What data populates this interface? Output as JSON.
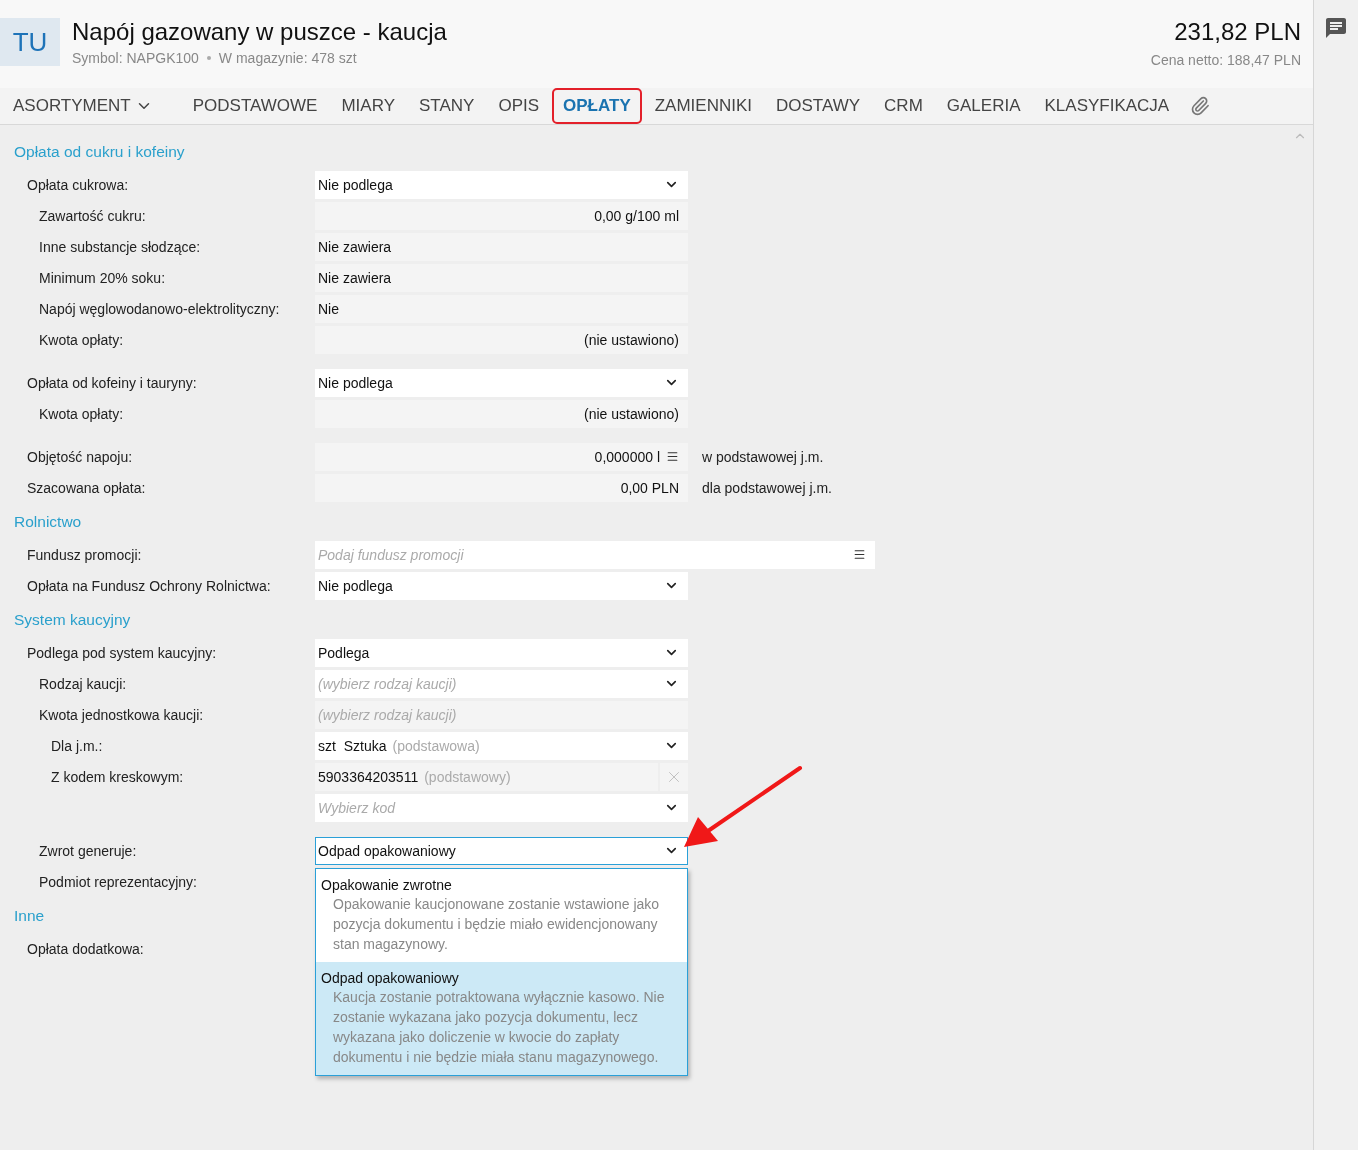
{
  "header": {
    "avatar": "TU",
    "title": "Napój gazowany w puszce - kaucja",
    "symbol": "Symbol: NAPGK100",
    "stock": "W magazynie: 478 szt",
    "price": "231,82 PLN",
    "net_price": "Cena netto: 188,47 PLN"
  },
  "tabs": [
    {
      "label": "ASORTYMENT",
      "kind": "dropdown",
      "selected": false,
      "highlighted": false
    },
    {
      "label": "PODSTAWOWE",
      "kind": "text",
      "selected": false,
      "highlighted": false
    },
    {
      "label": "MIARY",
      "kind": "text",
      "selected": false,
      "highlighted": false
    },
    {
      "label": "STANY",
      "kind": "text",
      "selected": false,
      "highlighted": false
    },
    {
      "label": "OPIS",
      "kind": "text",
      "selected": false,
      "highlighted": false
    },
    {
      "label": "OPŁATY",
      "kind": "text",
      "selected": true,
      "highlighted": true
    },
    {
      "label": "ZAMIENNIKI",
      "kind": "text",
      "selected": false,
      "highlighted": false
    },
    {
      "label": "DOSTAWY",
      "kind": "text",
      "selected": false,
      "highlighted": false
    },
    {
      "label": "CRM",
      "kind": "text",
      "selected": false,
      "highlighted": false
    },
    {
      "label": "GALERIA",
      "kind": "text",
      "selected": false,
      "highlighted": false
    },
    {
      "label": "KLASYFIKACJA",
      "kind": "text",
      "selected": false,
      "highlighted": false
    }
  ],
  "sections": [
    {
      "title": "Opłata od cukru i kofeiny",
      "rows": [
        {
          "label": "Opłata cukrowa:",
          "kind": "select",
          "value": "Nie podlega",
          "children": [
            {
              "label": "Zawartość cukru:",
              "kind": "amount",
              "value": "0,00 g/100 ml"
            },
            {
              "label": "Inne substancje słodzące:",
              "kind": "readonly",
              "value": "Nie zawiera"
            },
            {
              "label": "Minimum 20% soku:",
              "kind": "readonly",
              "value": "Nie zawiera"
            },
            {
              "label": "Napój węglowodanowo-elektrolityczny:",
              "kind": "readonly",
              "value": "Nie"
            },
            {
              "label": "Kwota opłaty:",
              "kind": "amount",
              "value": "(nie ustawiono)"
            }
          ]
        },
        {
          "label": "Opłata od kofeiny i tauryny:",
          "kind": "select",
          "value": "Nie podlega",
          "children": [
            {
              "label": "Kwota opłaty:",
              "kind": "amount",
              "value": "(nie ustawiono)"
            }
          ]
        },
        {
          "label": "Objętość napoju:",
          "kind": "amount_menu",
          "value": "0,000000 l",
          "suffix": "w podstawowej j.m."
        },
        {
          "label": "Szacowana opłata:",
          "kind": "amount",
          "value": "0,00 PLN",
          "suffix": "dla podstawowej j.m."
        }
      ]
    },
    {
      "title": "Rolnictwo",
      "rows": [
        {
          "label": "Fundusz promocji:",
          "kind": "lookup",
          "placeholder": "Podaj fundusz promocji"
        },
        {
          "label": "Opłata na Fundusz Ochrony Rolnictwa:",
          "kind": "select",
          "value": "Nie podlega"
        }
      ]
    },
    {
      "title": "System kaucyjny",
      "rows": [
        {
          "label": "Podlega pod system kaucyjny:",
          "kind": "select",
          "value": "Podlega",
          "children": [
            {
              "label": "Rodzaj kaucji:",
              "kind": "select",
              "placeholder": "(wybierz rodzaj kaucji)"
            },
            {
              "label": "Kwota jednostkowa kaucji:",
              "kind": "readonly",
              "placeholder": "(wybierz rodzaj kaucji)",
              "children": [
                {
                  "label": "Dla j.m.:",
                  "kind": "select",
                  "value": "szt  Sztuka",
                  "hint": "(podstawowa)"
                },
                {
                  "label": "Z kodem kreskowym:",
                  "kind": "barcode",
                  "value": "5903364203511",
                  "hint": "(podstawowy)"
                },
                {
                  "kind": "select",
                  "placeholder": "Wybierz kod"
                }
              ]
            },
            {
              "label": "Zwrot generuje:",
              "kind": "select",
              "value": "Odpad opakowaniowy",
              "focused": true,
              "dropdown": [
                {
                  "title": "Opakowanie zwrotne",
                  "description": "Opakowanie kaucjonowane zostanie wstawione jako pozycja dokumentu i będzie miało ewidencjonowany stan magazynowy.",
                  "selected": false
                },
                {
                  "title": "Odpad opakowaniowy",
                  "description": "Kaucja zostanie potraktowana wyłącznie kasowo. Nie zostanie wykazana jako pozycja dokumentu, lecz wykazana jako doliczenie w kwocie do zapłaty dokumentu i nie będzie miała stanu magazynowego.",
                  "selected": true
                }
              ]
            },
            {
              "label": "Podmiot reprezentacyjny:",
              "kind": "none"
            }
          ]
        }
      ]
    },
    {
      "title": "Inne",
      "rows": [
        {
          "label": "Opłata dodatkowa:",
          "kind": "none"
        }
      ]
    }
  ]
}
